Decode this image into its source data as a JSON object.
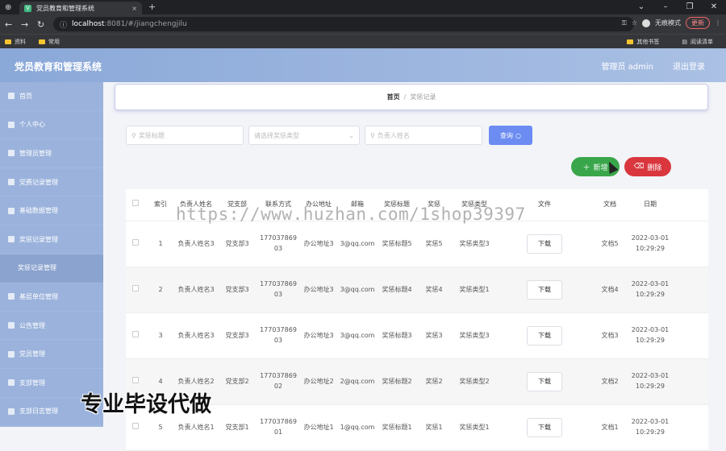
{
  "browser": {
    "tab_title": "党员教育和管理系统",
    "url_host": "localhost",
    "url_path": ":8081/#/jiangchengjilu",
    "incognito_label": "无痕模式",
    "update_label": "更新",
    "bookmarks": [
      "资料",
      "常用"
    ],
    "bookmarks_right": [
      "其他书签",
      "阅读清单"
    ]
  },
  "header": {
    "title": "党员教育和管理系统",
    "admin": "管理员 admin",
    "logout": "退出登录"
  },
  "sidebar": {
    "items": [
      {
        "label": "首页",
        "icon": "home-icon"
      },
      {
        "label": "个人中心",
        "icon": "user-icon"
      },
      {
        "label": "管理员管理",
        "icon": "grid-icon"
      },
      {
        "label": "党费记录管理",
        "icon": "user-icon"
      },
      {
        "label": "基础数据管理",
        "icon": "data-icon"
      },
      {
        "label": "奖惩记录管理",
        "icon": "chat-icon"
      },
      {
        "label": "奖惩记录管理",
        "icon": "",
        "sub": true
      },
      {
        "label": "基层单位管理",
        "icon": "grid-icon"
      },
      {
        "label": "公告管理",
        "icon": "list-icon"
      },
      {
        "label": "党员管理",
        "icon": "list-icon"
      },
      {
        "label": "支部管理",
        "icon": "list-icon"
      },
      {
        "label": "支部日志管理",
        "icon": "list-icon"
      }
    ]
  },
  "breadcrumb": {
    "home": "首页",
    "sep": "/",
    "current": "奖惩记录"
  },
  "filters": {
    "title_placeholder": "奖惩标题",
    "type_placeholder": "请选择奖惩类型",
    "person_placeholder": "负责人姓名",
    "search_label": "查询"
  },
  "actions": {
    "add_label": "新增",
    "delete_label": "删除"
  },
  "table": {
    "columns": [
      "索引",
      "负责人姓名",
      "党支部",
      "联系方式",
      "办公地址",
      "邮箱",
      "奖惩标题",
      "奖惩",
      "奖惩类型",
      "文件",
      "文档",
      "日期"
    ],
    "download_label": "下载",
    "rows": [
      {
        "idx": "1",
        "person": "负责人姓名3",
        "branch": "党支部3",
        "phone": "17703786903",
        "addr": "办公地址3",
        "email": "3@qq.com",
        "title": "奖惩标题5",
        "rp": "奖惩5",
        "type": "奖惩类型3",
        "doc": "文档5",
        "date": "2022-03-01 10:29:29"
      },
      {
        "idx": "2",
        "person": "负责人姓名3",
        "branch": "党支部3",
        "phone": "17703786903",
        "addr": "办公地址3",
        "email": "3@qq.com",
        "title": "奖惩标题4",
        "rp": "奖惩4",
        "type": "奖惩类型1",
        "doc": "文档4",
        "date": "2022-03-01 10:29:29"
      },
      {
        "idx": "3",
        "person": "负责人姓名3",
        "branch": "党支部3",
        "phone": "17703786903",
        "addr": "办公地址3",
        "email": "3@qq.com",
        "title": "奖惩标题3",
        "rp": "奖惩3",
        "type": "奖惩类型3",
        "doc": "文档3",
        "date": "2022-03-01 10:29:29"
      },
      {
        "idx": "4",
        "person": "负责人姓名2",
        "branch": "党支部2",
        "phone": "17703786902",
        "addr": "办公地址2",
        "email": "2@qq.com",
        "title": "奖惩标题2",
        "rp": "奖惩2",
        "type": "奖惩类型2",
        "doc": "文档2",
        "date": "2022-03-01 10:29:29"
      },
      {
        "idx": "5",
        "person": "负责人姓名1",
        "branch": "党支部1",
        "phone": "17703786901",
        "addr": "办公地址1",
        "email": "1@qq.com",
        "title": "奖惩标题1",
        "rp": "奖惩1",
        "type": "奖惩类型1",
        "doc": "文档1",
        "date": "2022-03-01 10:29:29"
      }
    ]
  },
  "overlay": {
    "watermark": "https://www.huzhan.com/1shop39397",
    "promo": "专业毕设代做"
  }
}
